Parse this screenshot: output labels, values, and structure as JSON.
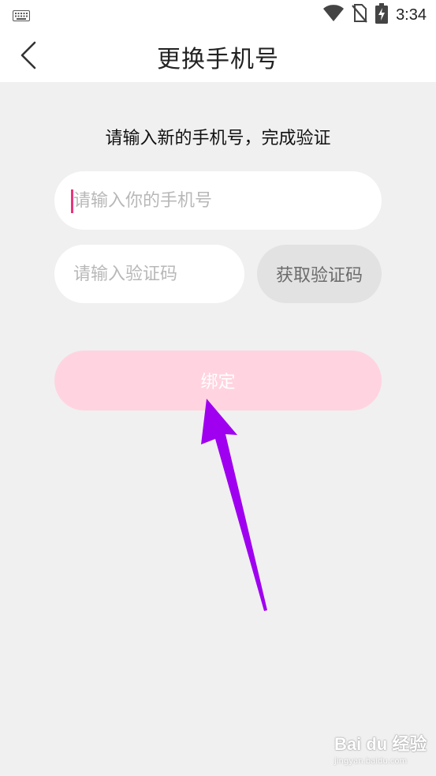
{
  "status_bar": {
    "time": "3:34",
    "icons": [
      "keyboard-icon",
      "wifi-icon",
      "no-sim-icon",
      "battery-charging-icon"
    ]
  },
  "header": {
    "title": "更换手机号",
    "back_icon": "chevron-left-icon"
  },
  "form": {
    "prompt": "请输入新的手机号，完成验证",
    "phone_placeholder": "请输入你的手机号",
    "phone_value": "",
    "code_placeholder": "请输入验证码",
    "code_value": "",
    "get_code_label": "获取验证码",
    "bind_label": "绑定"
  },
  "colors": {
    "caret": "#e8357d",
    "bind_button": "#ffd4e0",
    "get_code_button": "#e2e2e2",
    "annotation_arrow": "#a000f0"
  },
  "watermark": {
    "logo": "Bai du 经验",
    "url": "jingyan.baidu.com"
  }
}
